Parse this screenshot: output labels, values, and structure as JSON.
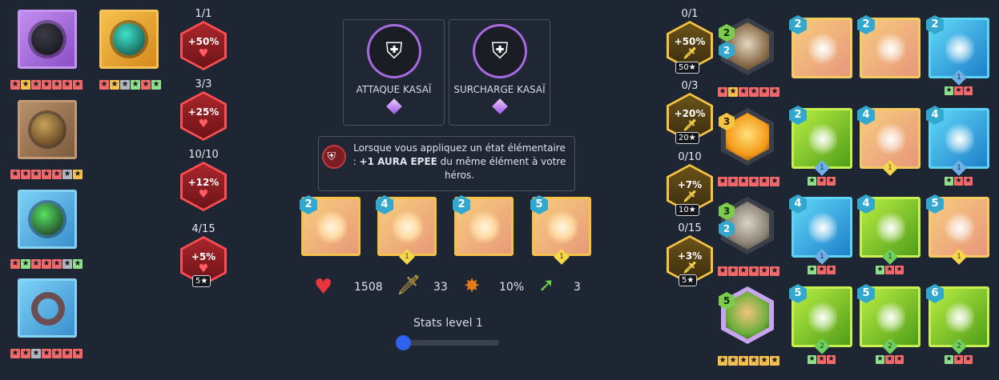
{
  "left_items": [
    {
      "name": "dark-ring",
      "color": "purple",
      "stars": [
        "red",
        "gold",
        "red",
        "red",
        "red",
        "red",
        "red"
      ]
    },
    {
      "name": "teal-bracer",
      "color": "orange",
      "stars": [
        "red",
        "gold",
        "grey",
        "green",
        "red",
        "green"
      ]
    },
    {
      "name": "bronze-ring",
      "color": "brown",
      "stars": [
        "red",
        "red",
        "red",
        "red",
        "red",
        "grey",
        "gold"
      ]
    },
    {
      "name": "green-gem-ring",
      "color": "blue",
      "stars": [
        "red",
        "green",
        "red",
        "red",
        "red",
        "grey",
        "green"
      ]
    },
    {
      "name": "stone-ring",
      "color": "blue",
      "stars": [
        "red",
        "red",
        "grey",
        "red",
        "red",
        "red",
        "red"
      ]
    }
  ],
  "hp_bonuses": [
    {
      "count": "1/1",
      "value": "+50%"
    },
    {
      "count": "3/3",
      "value": "+25%"
    },
    {
      "count": "10/10",
      "value": "+12%"
    },
    {
      "count": "4/15",
      "value": "+5%",
      "tag": "5★"
    }
  ],
  "spells": [
    {
      "label": "ATTAQUE KASAÏ",
      "icon": "kasai-attack-emblem"
    },
    {
      "label": "SURCHARGE KASAÏ",
      "icon": "kasai-overload-emblem"
    }
  ],
  "description": {
    "line1": "Lorsque vous appliquez un état élémentaire",
    "prefix": ": ",
    "bold": "+1 AURA EPEE",
    "line2_rest": " du même élément à votre",
    "line3": "héros."
  },
  "deck": [
    {
      "level": "2",
      "gem": ""
    },
    {
      "level": "4",
      "gem": "1"
    },
    {
      "level": "2",
      "gem": ""
    },
    {
      "level": "5",
      "gem": "1"
    }
  ],
  "stats": {
    "hp": "1508",
    "attack": "33",
    "crit": "10%",
    "range": "3"
  },
  "stats_level_label": "Stats level 1",
  "attack_bonuses": [
    {
      "count": "0/1",
      "value": "+50%",
      "tag": "50★"
    },
    {
      "count": "0/3",
      "value": "+20%",
      "tag": "20★"
    },
    {
      "count": "0/10",
      "value": "+7%",
      "tag": "10★"
    },
    {
      "count": "0/15",
      "value": "+3%",
      "tag": "5★"
    }
  ],
  "companions": [
    {
      "name": "bearded-sage",
      "levels": [
        "2",
        "2"
      ],
      "stars": [
        "red",
        "gold",
        "red",
        "red",
        "red",
        "red"
      ]
    },
    {
      "name": "orange-bird",
      "levels": [
        "3"
      ],
      "stars": [
        "red",
        "red",
        "red",
        "red",
        "red",
        "red"
      ]
    },
    {
      "name": "grey-cat",
      "levels": [
        "3",
        "2"
      ],
      "stars": [
        "red",
        "red",
        "red",
        "red",
        "red",
        "red"
      ]
    },
    {
      "name": "green-hair-hero",
      "levels": [
        "5"
      ],
      "stars": [
        "gold",
        "gold",
        "gold",
        "gold",
        "gold",
        "gold"
      ]
    }
  ],
  "companion_cards": [
    [
      {
        "level": "2",
        "color": "gold",
        "gem": ""
      },
      {
        "level": "2",
        "color": "gold",
        "gem": ""
      },
      {
        "level": "2",
        "color": "blue",
        "gem": "1",
        "gem_color": "blue",
        "mini": [
          "green",
          "red",
          "red"
        ]
      }
    ],
    [
      {
        "level": "2",
        "color": "green",
        "gem": "1",
        "gem_color": "blue",
        "mini": [
          "green",
          "red",
          "red"
        ]
      },
      {
        "level": "4",
        "color": "gold",
        "gem": "1",
        "gem_color": "yellow"
      },
      {
        "level": "4",
        "color": "blue",
        "gem": "1",
        "gem_color": "blue",
        "mini": [
          "green",
          "red",
          "red"
        ]
      }
    ],
    [
      {
        "level": "4",
        "color": "blue",
        "gem": "1",
        "gem_color": "blue",
        "mini": [
          "green",
          "red",
          "red"
        ]
      },
      {
        "level": "4",
        "color": "green",
        "gem": "1",
        "gem_color": "green",
        "mini": [
          "green",
          "red",
          "red"
        ]
      },
      {
        "level": "5",
        "color": "gold",
        "gem": "1",
        "gem_color": "yellow"
      }
    ],
    [
      {
        "level": "5",
        "color": "green",
        "gem": "2",
        "gem_color": "green",
        "mini": [
          "green",
          "red",
          "red"
        ]
      },
      {
        "level": "5",
        "color": "green",
        "gem": "2",
        "gem_color": "green",
        "mini": [
          "green",
          "red",
          "red"
        ]
      },
      {
        "level": "6",
        "color": "green",
        "gem": "2",
        "gem_color": "green",
        "mini": [
          "green",
          "red",
          "red"
        ]
      }
    ]
  ],
  "colors": {
    "background": "#1e2533",
    "accent_blue": "#2e63f0",
    "hp_red": "#ff4e52",
    "attack_gold": "#f6c343"
  }
}
